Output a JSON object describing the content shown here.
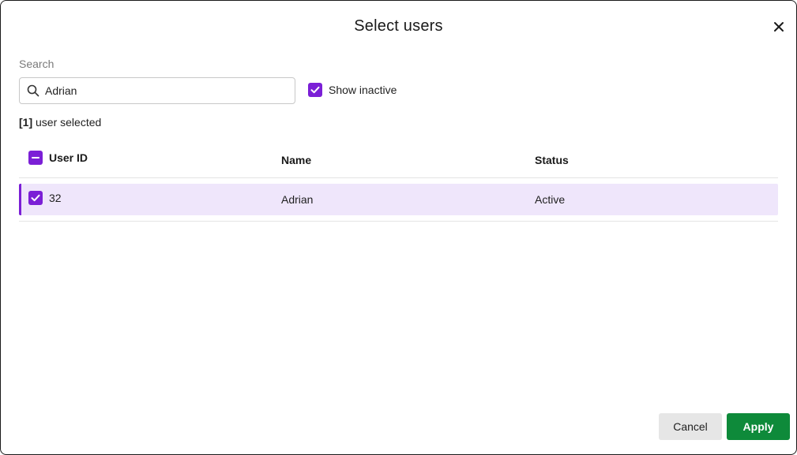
{
  "dialog": {
    "title": "Select users",
    "close_icon": "close-icon"
  },
  "search": {
    "label": "Search",
    "value": "Adrian",
    "placeholder": "",
    "icon": "search-icon"
  },
  "show_inactive": {
    "label": "Show inactive",
    "checked": true
  },
  "selection_summary": {
    "count": "[1]",
    "text": " user selected"
  },
  "table": {
    "header_checkbox_state": "indeterminate",
    "columns": [
      "User ID",
      "Name",
      "Status"
    ],
    "rows": [
      {
        "selected": true,
        "user_id": "32",
        "name": "Adrian",
        "status": "Active"
      }
    ]
  },
  "footer": {
    "cancel_label": "Cancel",
    "apply_label": "Apply"
  },
  "colors": {
    "accent": "#7b1fd6",
    "selected_row": "#efe6fb",
    "apply_button": "#0e8a3a"
  }
}
